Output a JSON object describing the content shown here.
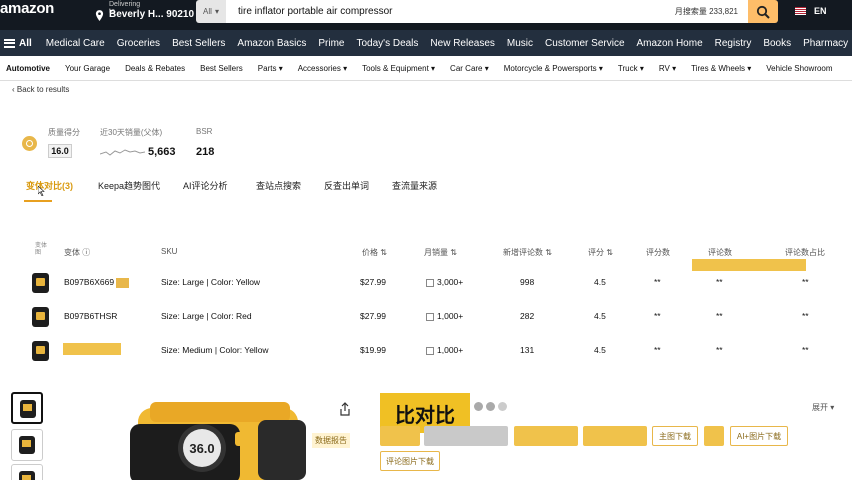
{
  "header": {
    "logo": "amazon",
    "deliver_to": "Delivering to",
    "location": "Beverly H... 90210",
    "search_category": "All",
    "search_value": "tire inflator portable air compressor",
    "search_volume": "月搜索量 233,821",
    "language": "EN"
  },
  "nav": {
    "all": "All",
    "items": [
      "Medical Care",
      "Groceries",
      "Best Sellers",
      "Amazon Basics",
      "Prime",
      "Today's Deals",
      "New Releases",
      "Music",
      "Customer Service",
      "Amazon Home",
      "Registry",
      "Books",
      "Pharmacy"
    ]
  },
  "subnav": {
    "items": [
      "Automotive",
      "Your Garage",
      "Deals & Rebates",
      "Best Sellers",
      "Parts",
      "Accessories",
      "Tools & Equipment",
      "Car Care",
      "Motorcycle & Powersports",
      "Truck",
      "RV",
      "Tires & Wheels",
      "Vehicle Showroom"
    ]
  },
  "back_to_results": "Back to results",
  "stats": {
    "quality_label": "质量得分",
    "quality_value": "16.0",
    "sales_label": "近30天销量(父体)",
    "sales_value": "5,663",
    "bsr_label": "BSR",
    "bsr_value": "218"
  },
  "tabs": [
    "变体对比(3)",
    "Keepa趋势图代",
    "AI评论分析",
    "查站点搜索",
    "反查出单词",
    "查流量来源"
  ],
  "table": {
    "headers": {
      "image": "变体图",
      "variant": "变体",
      "sku": "SKU",
      "price": "价格",
      "sales": "月销量",
      "reviews": "新增评论数",
      "rating": "评分",
      "rating_count": "评分数",
      "review_count": "评论数",
      "review_ratio": "评论数占比"
    },
    "rows": [
      {
        "asin": "B097B6X669",
        "sku": "Size: Large | Color: Yellow",
        "price": "$27.99",
        "sales": "3,000+",
        "reviews": "998",
        "rating": "4.5",
        "rating_count": "**",
        "review_count": "**",
        "review_ratio": "**"
      },
      {
        "asin": "B097B6THSR",
        "sku": "Size: Large | Color: Red",
        "price": "$27.99",
        "sales": "1,000+",
        "reviews": "282",
        "rating": "4.5",
        "rating_count": "**",
        "review_count": "**",
        "review_ratio": "**"
      },
      {
        "asin": "",
        "sku": "Size: Medium | Color: Yellow",
        "price": "$19.99",
        "sales": "1,000+",
        "reviews": "131",
        "rating": "4.5",
        "rating_count": "**",
        "review_count": "**",
        "review_ratio": "**"
      }
    ]
  },
  "bottom": {
    "caption": "比对比",
    "expand": "展开",
    "product_display": "36.0",
    "left_label": "数据报告",
    "buttons": [
      "主图下载",
      "AI+图片下载",
      "评论图片下载"
    ]
  },
  "colors": {
    "nav_dark": "#131921",
    "nav2": "#232f3e",
    "search_button": "#febd69",
    "accent_yellow": "#f0c24b"
  }
}
